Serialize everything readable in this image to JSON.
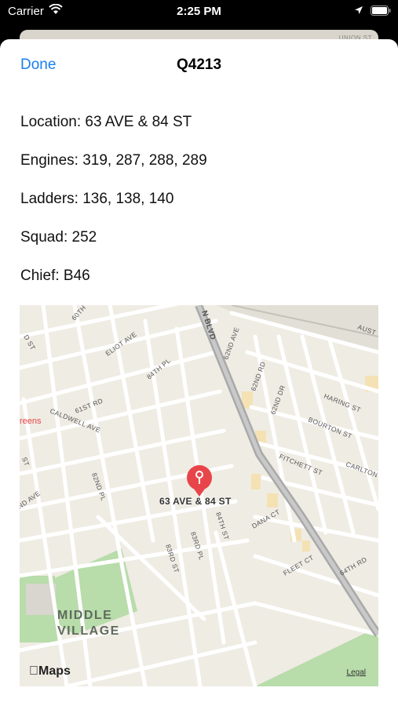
{
  "status_bar": {
    "carrier": "Carrier",
    "time": "2:25 PM"
  },
  "background_card": {
    "street_label": "UNION ST"
  },
  "nav": {
    "done_label": "Done",
    "title": "Q4213"
  },
  "details": {
    "location": "Location: 63 AVE & 84 ST",
    "engines": "Engines: 319, 287, 288, 289",
    "ladders": "Ladders: 136, 138, 140",
    "squad": "Squad: 252",
    "chief": "Chief: B46"
  },
  "map": {
    "pin_label": "63 AVE & 84 ST",
    "place_label_line1": "MIDDLE",
    "place_label_line2": "VILLAGE",
    "poi_fragment": "reens",
    "attribution": "Maps",
    "legal": "Legal",
    "streets": {
      "s60th": "60TH",
      "eliot": "ELIOT AVE",
      "s84pl": "84TH PL",
      "s61rd": "61ST RD",
      "caldwell": "CALDWELL AVE",
      "s82pl": "82ND PL",
      "ndave": "ND AVE",
      "dst": "D ST",
      "st": "ST",
      "blvd": "N BLVD",
      "s62ave": "62ND AVE",
      "s62rd": "62ND RD",
      "s62dr": "62ND DR",
      "haring": "HARING ST",
      "bourton": "BOURTON ST",
      "fitchett": "FITCHETT ST",
      "carlton": "CARLTON",
      "aust": "AUST",
      "s84st": "84TH ST",
      "s83pl": "83RD PL",
      "s83st": "83RD ST",
      "dana": "DANA CT",
      "fleet": "FLEET CT",
      "s64rd": "64TH RD"
    }
  },
  "colors": {
    "accent": "#1a7ef0",
    "pin": "#e8454a",
    "park": "#b8dcaa",
    "road": "#ffffff",
    "highway": "#a9a9a9",
    "map_bg": "#efece4"
  }
}
